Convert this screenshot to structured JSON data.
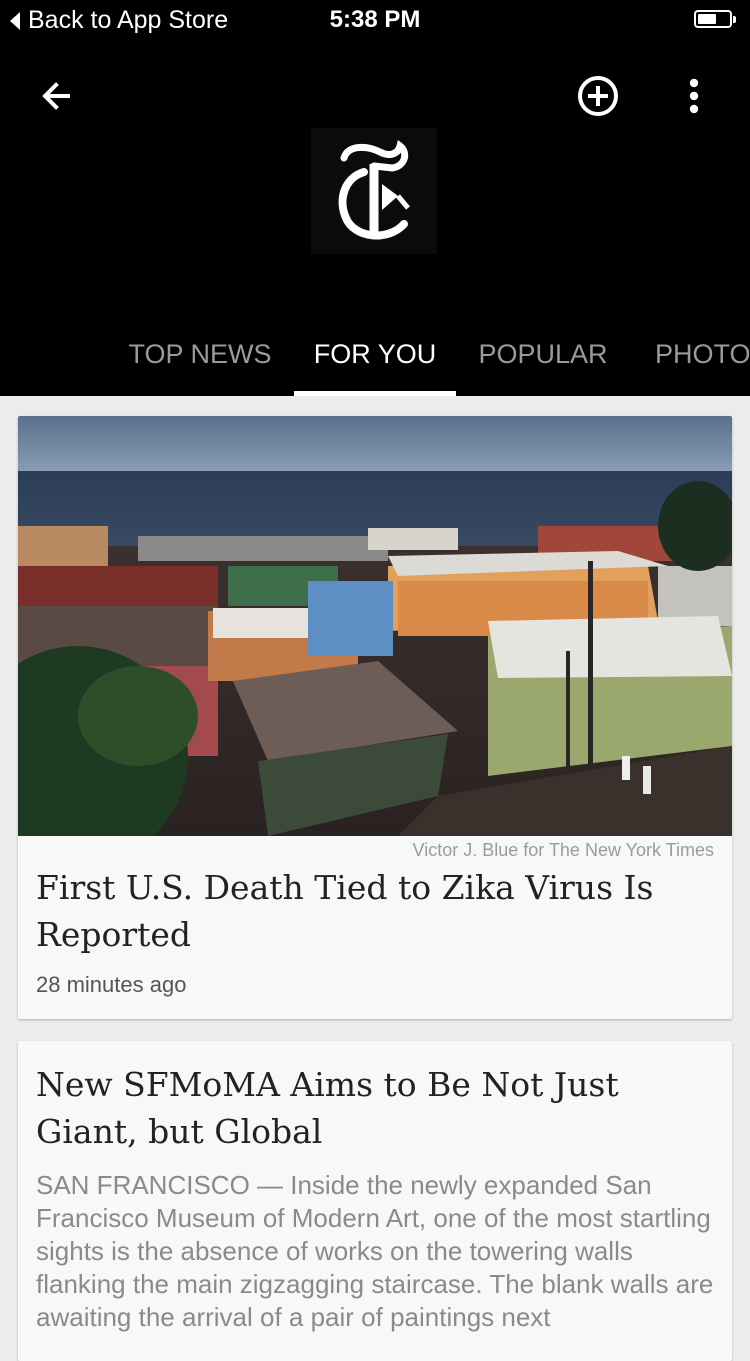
{
  "status_bar": {
    "back_label": "Back to App Store",
    "time": "5:38 PM",
    "battery_level": 0.5
  },
  "app_bar": {
    "icons": {
      "back": "arrow-left-icon",
      "add": "add-circle-icon",
      "more": "more-vertical-icon",
      "logo": "nyt-t-logo"
    }
  },
  "tabs": [
    {
      "label": "TOP NEWS",
      "active": false
    },
    {
      "label": "FOR YOU",
      "active": true
    },
    {
      "label": "POPULAR",
      "active": false
    },
    {
      "label": "PHOTOS",
      "active": false
    }
  ],
  "articles": [
    {
      "photo_credit": "Victor J. Blue for The New York Times",
      "headline": "First U.S. Death Tied to Zika Virus Is Reported",
      "time_ago": "28 minutes ago"
    },
    {
      "headline": "New SFMoMA Aims to Be Not Just Giant, but Global",
      "summary": "SAN FRANCISCO — Inside the newly expanded San Francisco Museum of Modern Art, one of the most startling sights is the absence of works on the towering walls flanking the main zigzagging staircase. The blank walls are awaiting the arrival of a pair of paintings next"
    }
  ],
  "colors": {
    "app_bar": "#000000",
    "background": "#ececec",
    "card": "#f8f8f8",
    "tab_active": "#ffffff",
    "tab_inactive": "#9a9a9a"
  }
}
